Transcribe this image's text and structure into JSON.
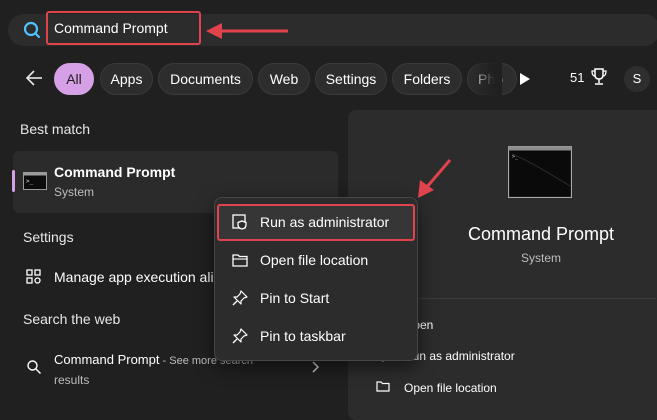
{
  "search": {
    "value": "Command Prompt"
  },
  "filters": [
    {
      "label": "All",
      "active": true
    },
    {
      "label": "Apps"
    },
    {
      "label": "Documents"
    },
    {
      "label": "Web"
    },
    {
      "label": "Settings"
    },
    {
      "label": "Folders"
    },
    {
      "label": "Pho"
    }
  ],
  "header_right": {
    "points": "51",
    "avatar_initial": "S"
  },
  "best_match": {
    "section_title": "Best match",
    "title": "Command Prompt",
    "subtitle": "System"
  },
  "settings": {
    "section_title": "Settings",
    "item": "Manage app execution aliases"
  },
  "web": {
    "section_title": "Search the web",
    "title": "Command Prompt",
    "suffix": " - See more search",
    "line2": "results"
  },
  "right_pane": {
    "title": "Command Prompt",
    "subtitle": "System",
    "actions": [
      "Open",
      "Run as administrator",
      "Open file location"
    ]
  },
  "context_menu": [
    {
      "label": "Run as administrator",
      "icon": "shield-icon"
    },
    {
      "label": "Open file location",
      "icon": "folder-icon"
    },
    {
      "label": "Pin to Start",
      "icon": "pin-icon"
    },
    {
      "label": "Pin to taskbar",
      "icon": "pin-icon"
    }
  ],
  "colors": {
    "accent": "#d6a0e6",
    "highlight_border": "#e0434b",
    "background": "#202020",
    "panel": "#2c2c2c"
  }
}
